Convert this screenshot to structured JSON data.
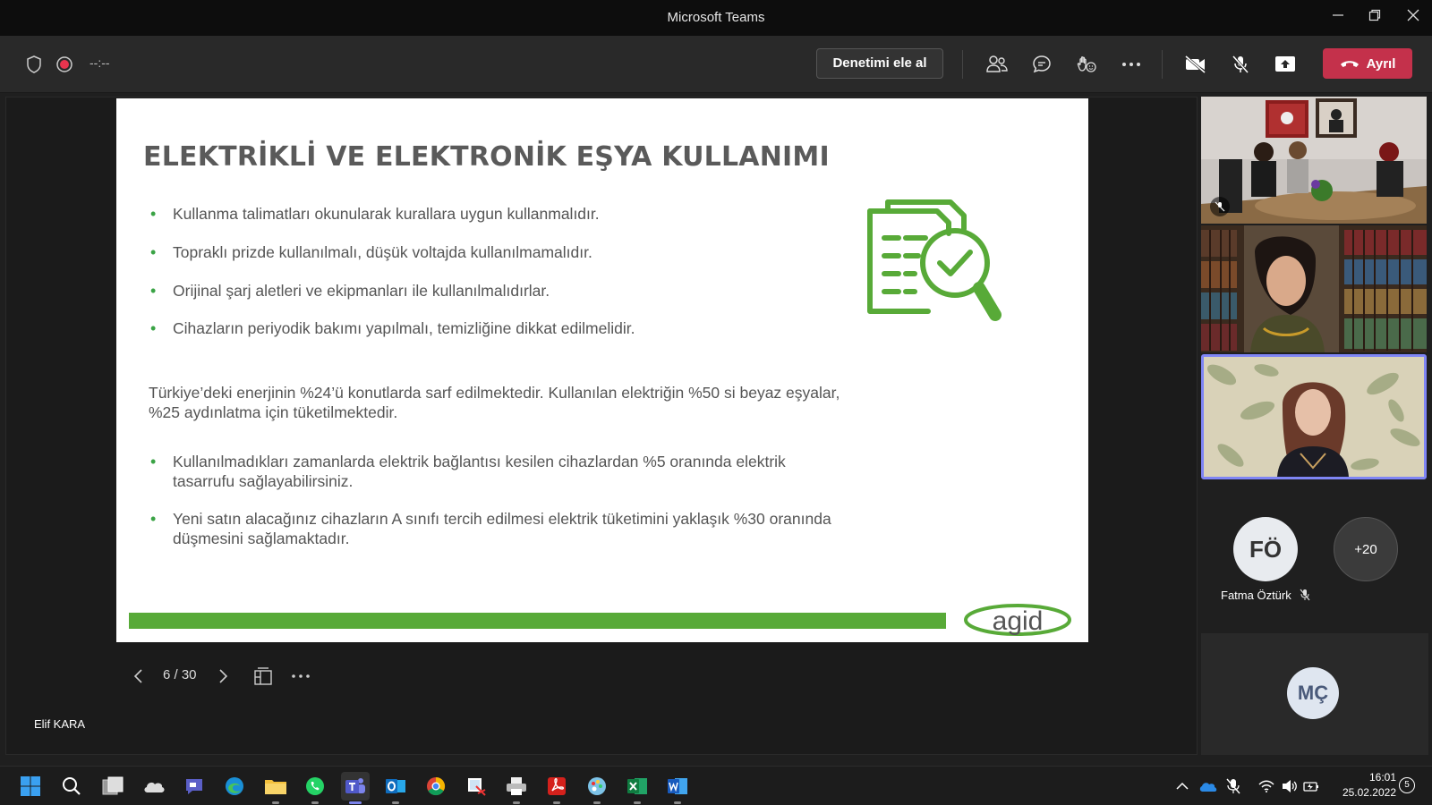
{
  "window": {
    "title": "Microsoft Teams"
  },
  "toolbar": {
    "timer": "--:--",
    "take_control": "Denetimi ele al",
    "leave": "Ayrıl"
  },
  "slide": {
    "title": "ELEKTRİKLİ VE ELEKTRONİK EŞYA KULLANIMI",
    "bullets_top": [
      "Kullanma talimatları okunularak kurallara uygun kullanmalıdır.",
      "Topraklı prizde kullanılmalı, düşük voltajda kullanılmamalıdır.",
      "Orijinal şarj aletleri ve ekipmanları ile kullanılmalıdırlar.",
      "Cihazların periyodik bakımı yapılmalı, temizliğine dikkat edilmelidir."
    ],
    "paragraph_line1": "Türkiye’deki enerjinin %24’ü konutlarda sarf edilmektedir. Kullanılan elektriğin %50 si beyaz eşyalar,",
    "paragraph_line2": "%25 aydınlatma için tüketilmektedir.",
    "bullets_bottom": [
      {
        "line1": "Kullanılmadıkları zamanlarda elektrik bağlantısı kesilen cihazlardan %5 oranında elektrik",
        "line2": "tasarrufu sağlayabilirsiniz."
      },
      {
        "line1": "Yeni satın alacağınız cihazların A sınıfı tercih edilmesi elektrik tüketimini yaklaşık %30 oranında",
        "line2": "düşmesini sağlamaktadır."
      }
    ],
    "logo_text": "agid",
    "accent_color": "#58aa38"
  },
  "slide_controls": {
    "page": "6 / 30"
  },
  "presenter": {
    "name": "Elif KARA"
  },
  "participants": {
    "fo_initials": "FÖ",
    "fo_name": "Fatma Öztürk",
    "more_count": "+20",
    "mc_initials": "MÇ"
  },
  "taskbar": {
    "time": "16:01",
    "date": "25.02.2022",
    "notifications": "5"
  }
}
